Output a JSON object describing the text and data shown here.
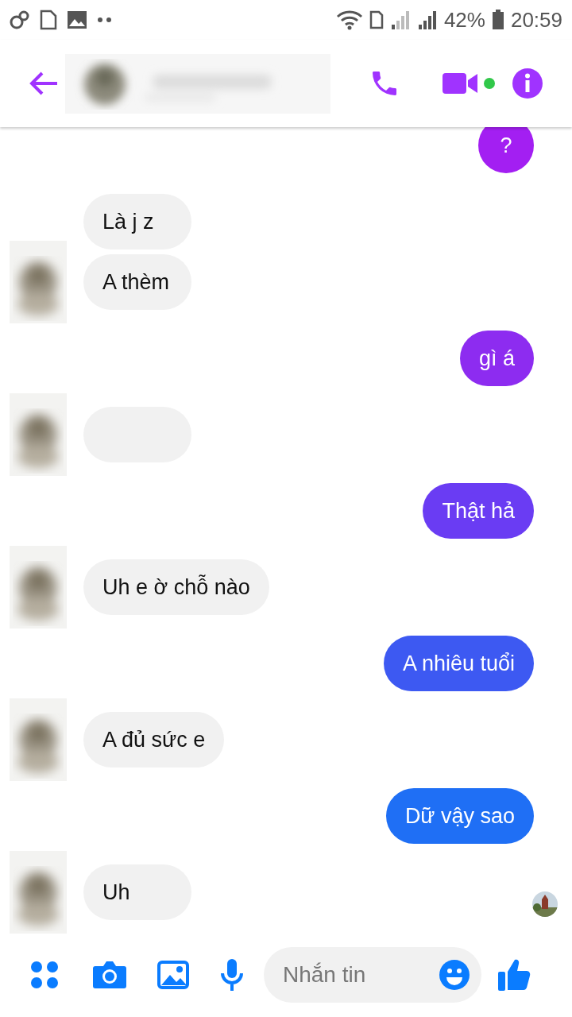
{
  "status_bar": {
    "battery": "42%",
    "time": "20:59"
  },
  "messages": [
    {
      "kind": "sent",
      "text": "?",
      "color": "#a31ff2"
    },
    {
      "kind": "received",
      "text": "Là j z",
      "avatar": false
    },
    {
      "kind": "received",
      "text": "A thèm",
      "avatar": true
    },
    {
      "kind": "sent",
      "text": "gì á",
      "color": "#8d2cf0"
    },
    {
      "kind": "received",
      "avatar": true
    },
    {
      "kind": "sent",
      "text": "Thật hả",
      "color": "#6a3cf3"
    },
    {
      "kind": "received",
      "text": "Uh e ờ chỗ nào",
      "avatar": true
    },
    {
      "kind": "sent",
      "text": "A nhiêu tuổi",
      "color": "#3d59f2"
    },
    {
      "kind": "received",
      "text": "A đủ sức e",
      "avatar": true
    },
    {
      "kind": "sent",
      "text": "Dữ vậy sao",
      "color": "#1f6ff5"
    },
    {
      "kind": "received",
      "text": "Uh",
      "avatar": true,
      "seen": true
    }
  ],
  "composer": {
    "placeholder": "Nhắn tin"
  }
}
